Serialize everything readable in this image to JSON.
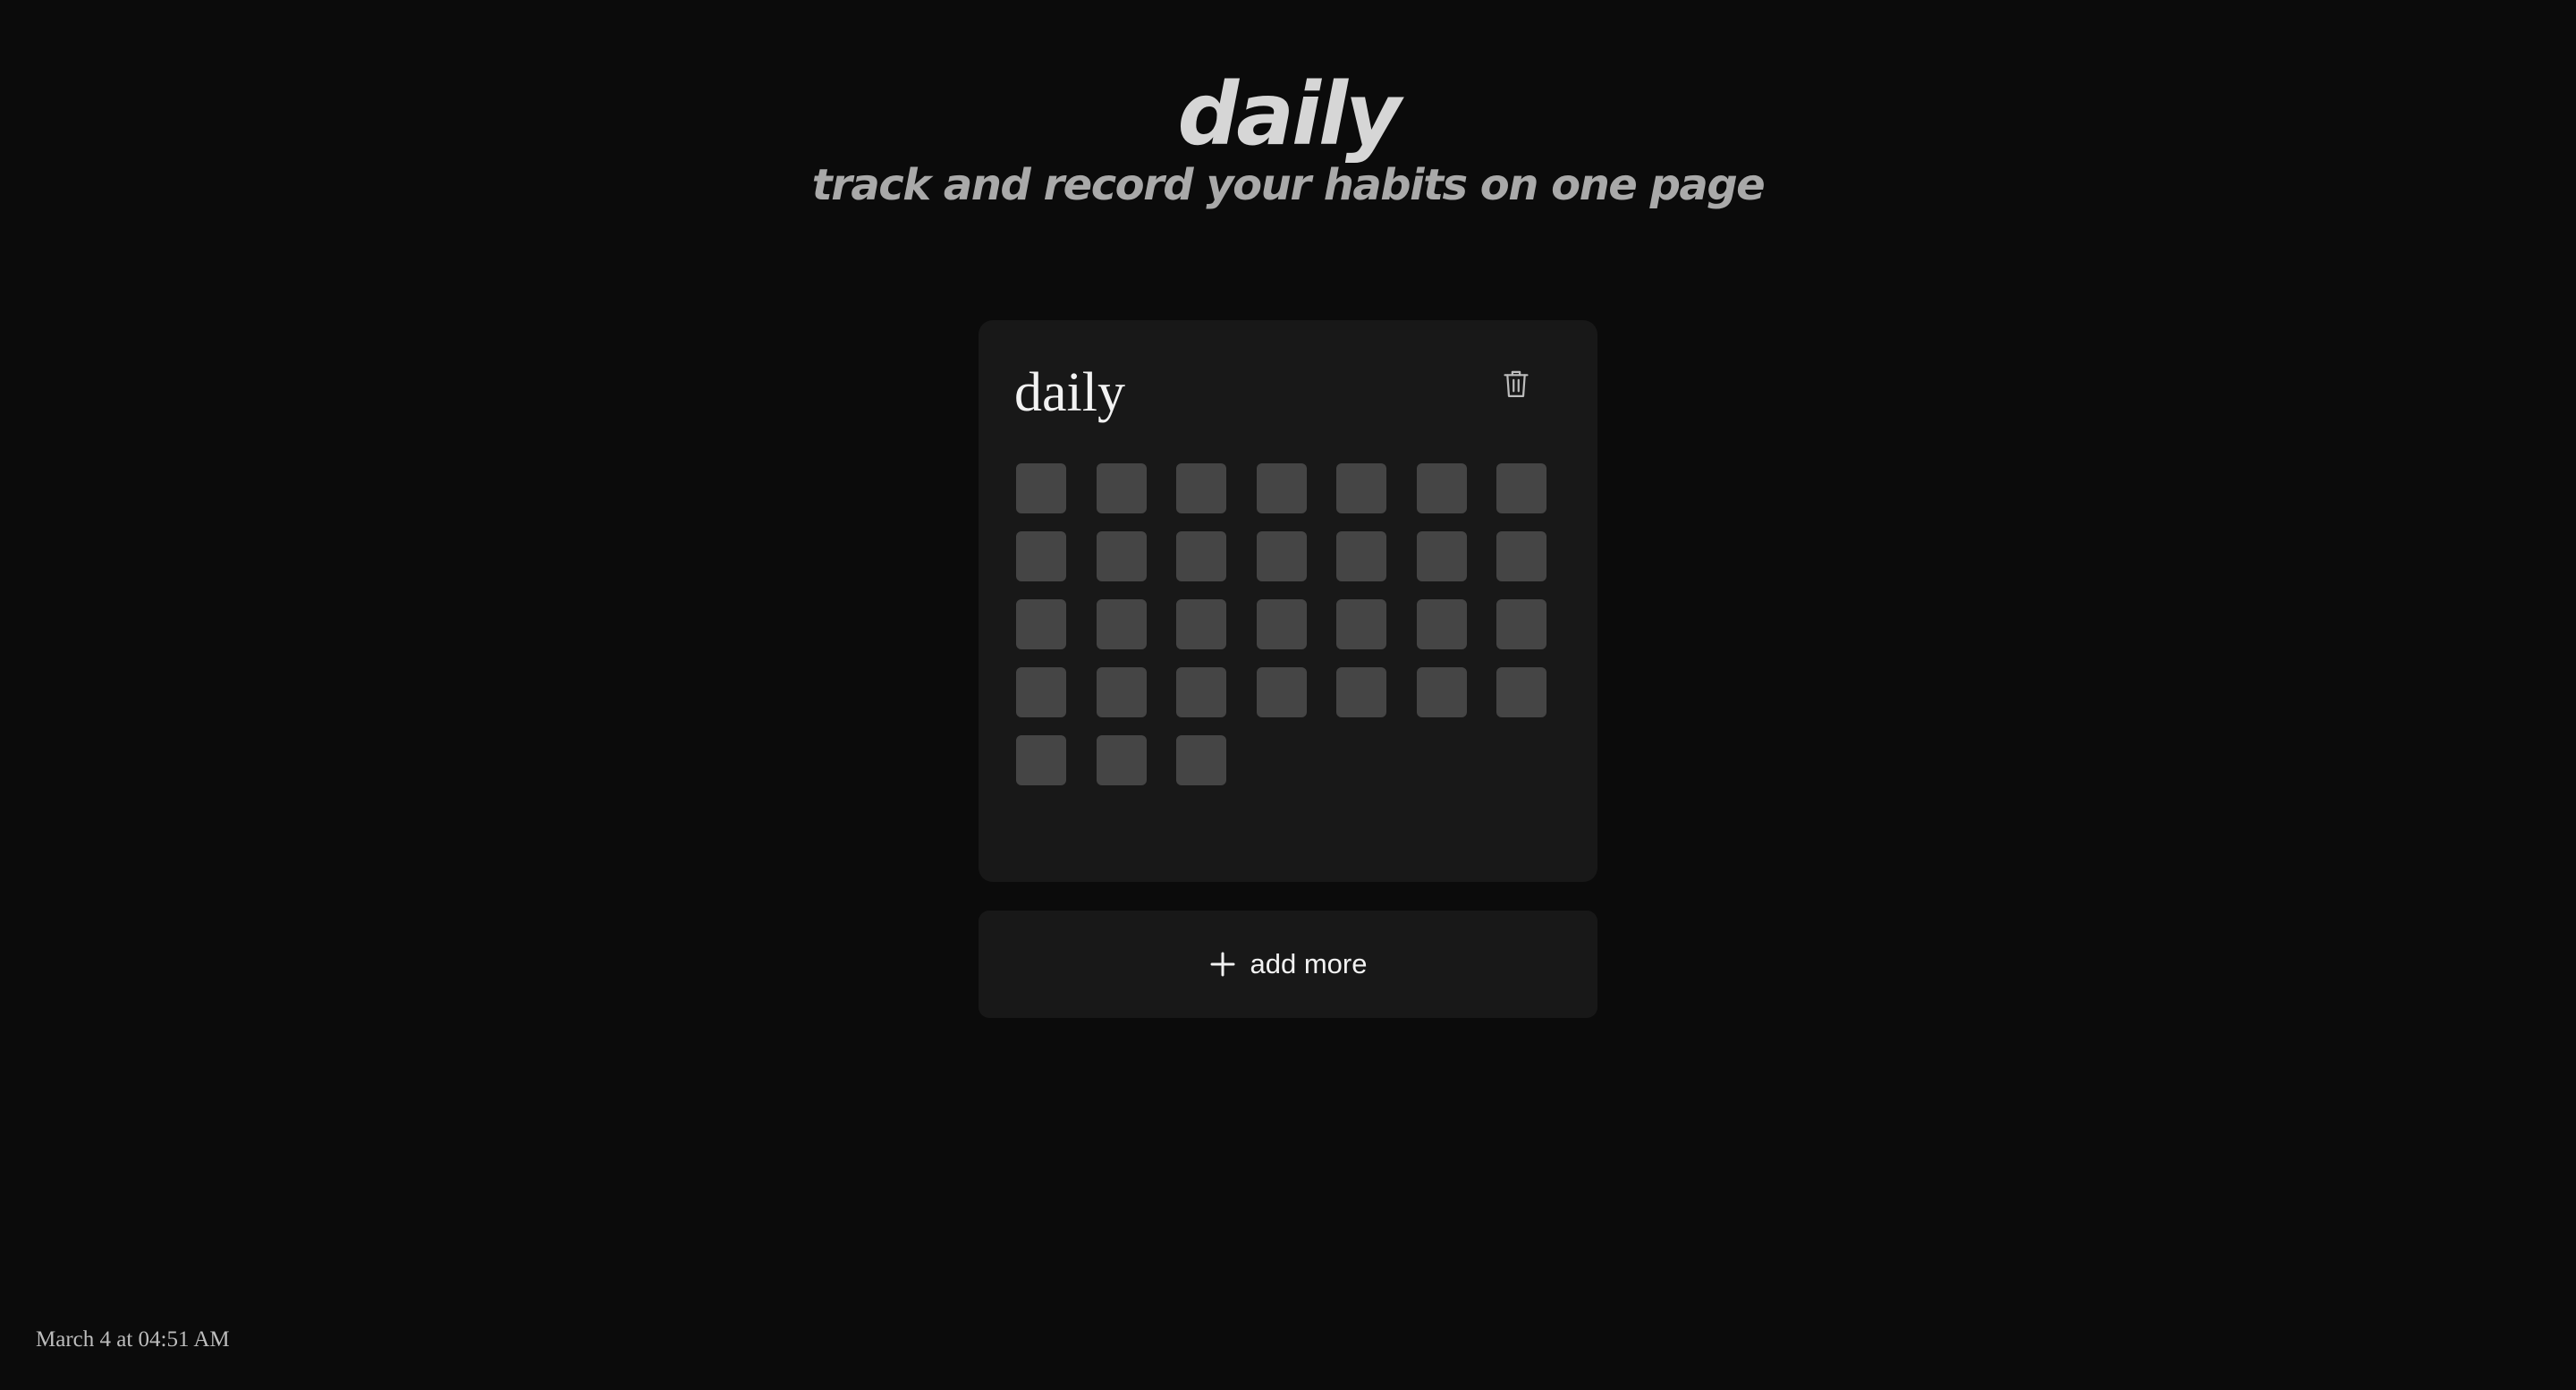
{
  "header": {
    "title": "daily",
    "subtitle": "track and record your habits on one page"
  },
  "habit": {
    "name": "daily",
    "delete_icon": "trash-icon",
    "day_count": 31
  },
  "add_more": {
    "label": "add more",
    "icon": "plus-icon"
  },
  "footer": {
    "timestamp": "March 4 at 04:51 AM"
  },
  "colors": {
    "background": "#0b0b0b",
    "card": "#181818",
    "cell": "#454545",
    "title": "#d6d6d6",
    "subtitle": "#a9a9a9"
  }
}
